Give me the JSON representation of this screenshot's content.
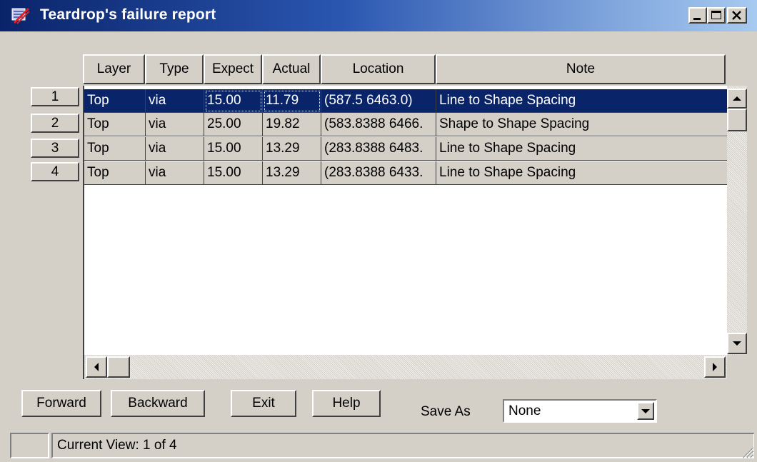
{
  "window": {
    "title": "Teardrop's failure report",
    "controls": [
      "minimize",
      "maximize",
      "close"
    ]
  },
  "table": {
    "columns": [
      "Layer",
      "Type",
      "Expect",
      "Actual",
      "Location",
      "Note"
    ],
    "row_labels": [
      "1",
      "2",
      "3",
      "4"
    ],
    "rows": [
      [
        "Top",
        "via",
        "15.00",
        "11.79",
        "(587.5 6463.0)",
        "Line to Shape Spacing"
      ],
      [
        "Top",
        "via",
        "25.00",
        "19.82",
        "(583.8388 6466.",
        "Shape to Shape Spacing"
      ],
      [
        "Top",
        "via",
        "15.00",
        "13.29",
        "(283.8388 6483.",
        "Line to Shape Spacing"
      ],
      [
        "Top",
        "via",
        "15.00",
        "13.29",
        "(283.8388 6433.",
        "Line to Shape Spacing"
      ]
    ],
    "selected_row": 1
  },
  "buttons": {
    "forward": "Forward",
    "backward": "Backward",
    "exit": "Exit",
    "help": "Help"
  },
  "save_as": {
    "label": "Save As",
    "value": "None"
  },
  "status": {
    "text": "Current View: 1 of 4"
  },
  "colors": {
    "selection": "#0a246a",
    "face": "#d4d0c8"
  }
}
